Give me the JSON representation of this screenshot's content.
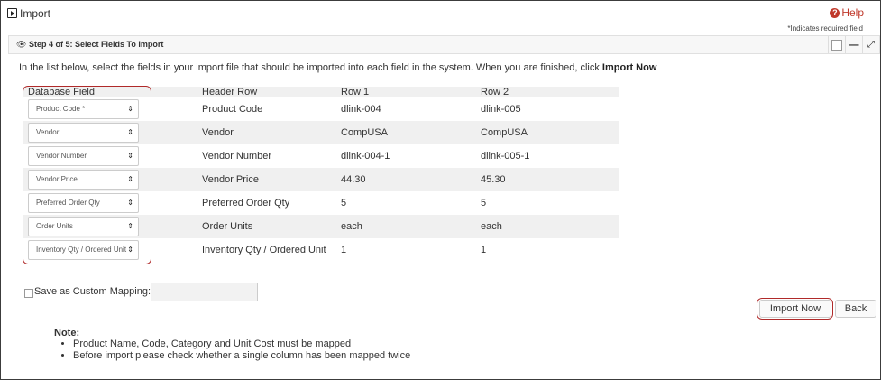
{
  "window": {
    "title": "Import",
    "help_label": "Help"
  },
  "required_note": "*Indicates required field",
  "step": {
    "label": "Step 4 of 5: Select Fields To Import"
  },
  "instruction": {
    "text": "In the list below, select the fields in your import file that should be imported into each field in the system. When you are finished, click ",
    "bold": "Import Now"
  },
  "mapping": {
    "columns": [
      "Database Field",
      "Header Row",
      "Row 1",
      "Row 2"
    ],
    "rows": [
      {
        "field": "Product Code *",
        "header": "Product Code",
        "row1": "dlink-004",
        "row2": "dlink-005"
      },
      {
        "field": "Vendor",
        "header": "Vendor",
        "row1": "CompUSA",
        "row2": "CompUSA"
      },
      {
        "field": "Vendor Number",
        "header": "Vendor Number",
        "row1": "dlink-004-1",
        "row2": "dlink-005-1"
      },
      {
        "field": "Vendor Price",
        "header": "Vendor Price",
        "row1": "44.30",
        "row2": "45.30"
      },
      {
        "field": "Preferred Order Qty",
        "header": "Preferred Order Qty",
        "row1": "5",
        "row2": "5"
      },
      {
        "field": "Order Units",
        "header": "Order Units",
        "row1": "each",
        "row2": "each"
      },
      {
        "field": "Inventory Qty / Ordered Unit",
        "header": "Inventory Qty / Ordered Unit",
        "row1": "1",
        "row2": "1"
      }
    ]
  },
  "save_mapping": {
    "label": "Save as Custom Mapping:",
    "value": ""
  },
  "buttons": {
    "import_now": "Import Now",
    "back": "Back"
  },
  "notes": {
    "title": "Note:",
    "items": [
      "Product Name, Code, Category and Unit Cost must be mapped",
      "Before import please check whether a single column has been mapped twice"
    ]
  },
  "colors": {
    "accent_red": "#b02a2a",
    "help_red": "#c0392b",
    "stripe": "#f0f0f0"
  }
}
